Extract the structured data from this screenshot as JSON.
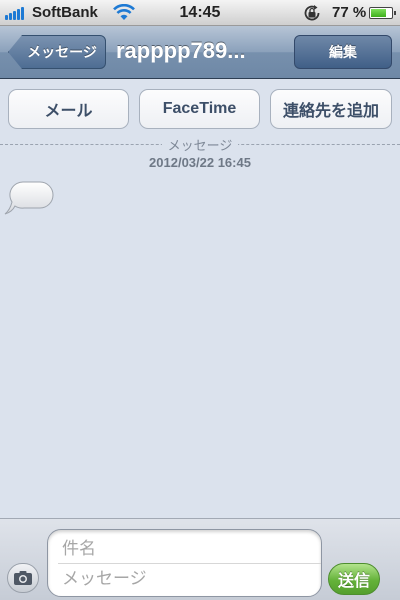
{
  "status_bar": {
    "carrier": "SoftBank",
    "time": "14:45",
    "battery_percent": "77 %",
    "battery_level": 0.77,
    "icons": [
      "signal-icon",
      "wifi-icon",
      "rotation-lock-icon",
      "battery-icon"
    ]
  },
  "nav": {
    "back_label": "メッセージ",
    "title": "rapppp789...",
    "edit_label": "編集"
  },
  "actions": {
    "mail_label": "メール",
    "facetime_label": "FaceTime",
    "add_contact_label": "連絡先を追加"
  },
  "thread": {
    "divider_label": "メッセージ",
    "timestamp": "2012/03/22 16:45"
  },
  "compose": {
    "subject_placeholder": "件名",
    "message_placeholder": "メッセージ",
    "subject_value": "",
    "message_value": "",
    "send_label": "送信"
  },
  "colors": {
    "nav_bar": "#7790ad",
    "background": "#dbe2ed",
    "send_green": "#64b239"
  }
}
